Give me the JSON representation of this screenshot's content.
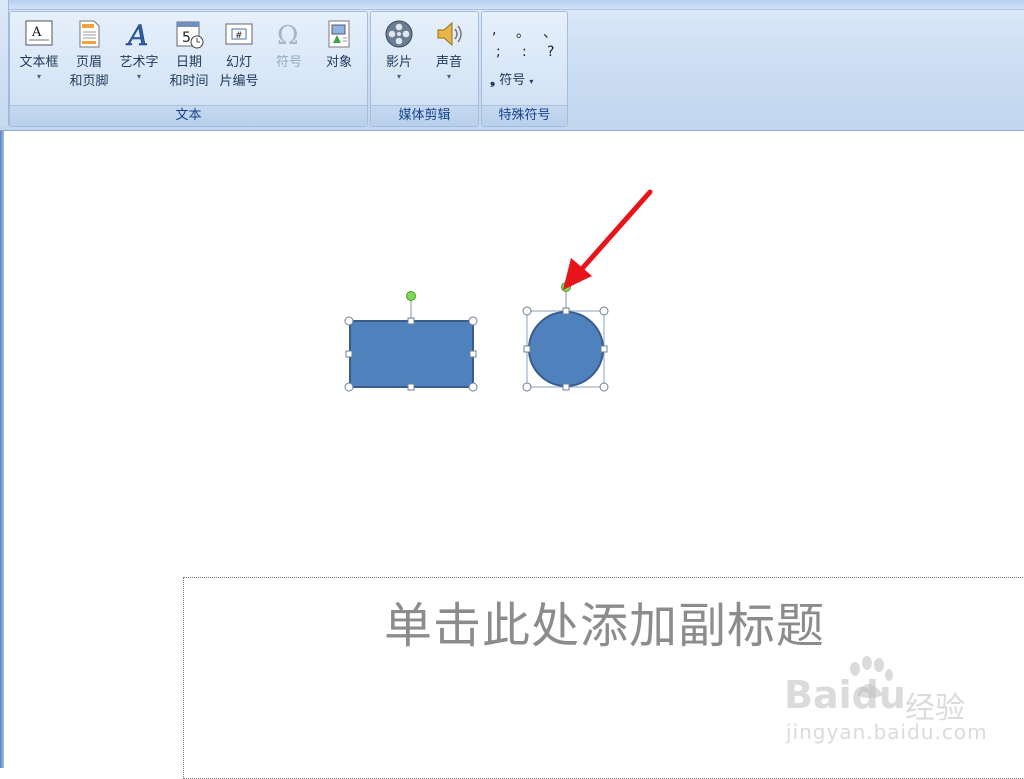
{
  "ribbon": {
    "groups": [
      {
        "label": "文本"
      },
      {
        "label": "媒体剪辑"
      },
      {
        "label": "特殊符号"
      }
    ],
    "text_buttons": [
      {
        "line1": "文本框",
        "line2": "",
        "icon": "textbox-icon",
        "dropdown": true
      },
      {
        "line1": "页眉",
        "line2": "和页脚",
        "icon": "header-footer-icon",
        "dropdown": false
      },
      {
        "line1": "艺术字",
        "line2": "",
        "icon": "wordart-icon",
        "dropdown": true
      },
      {
        "line1": "日期",
        "line2": "和时间",
        "icon": "date-time-icon",
        "dropdown": false
      },
      {
        "line1": "幻灯",
        "line2": "片编号",
        "icon": "slide-number-icon",
        "dropdown": false
      },
      {
        "line1": "符号",
        "line2": "",
        "icon": "omega-symbol-icon",
        "dropdown": false,
        "disabled": true
      },
      {
        "line1": "对象",
        "line2": "",
        "icon": "object-icon",
        "dropdown": false
      }
    ],
    "media_buttons": [
      {
        "line1": "影片",
        "icon": "film-reel-icon",
        "dropdown": true
      },
      {
        "line1": "声音",
        "icon": "speaker-icon",
        "dropdown": true
      }
    ],
    "special_symbols": {
      "row1": [
        ",",
        "。",
        "、"
      ],
      "row2": [
        ";",
        ":",
        "?"
      ],
      "more_label": "符号",
      "dropdown_glyph": "▾"
    }
  },
  "slide": {
    "subtitle_placeholder": "单击此处添加副标题",
    "shapes": [
      {
        "kind": "rectangle",
        "fill": "#4f81bd",
        "stroke": "#385d8a",
        "selected": true
      },
      {
        "kind": "ellipse",
        "fill": "#4f81bd",
        "stroke": "#385d8a",
        "selected": true
      }
    ],
    "annotation_arrow_color": "#e8141c"
  },
  "watermark": {
    "brand": "Bai",
    "brand2": "du",
    "brand_cn": "经验",
    "url": "jingyan.baidu.com"
  },
  "colors": {
    "accent": "#4f81bd",
    "ribbon_text": "#15428b"
  }
}
